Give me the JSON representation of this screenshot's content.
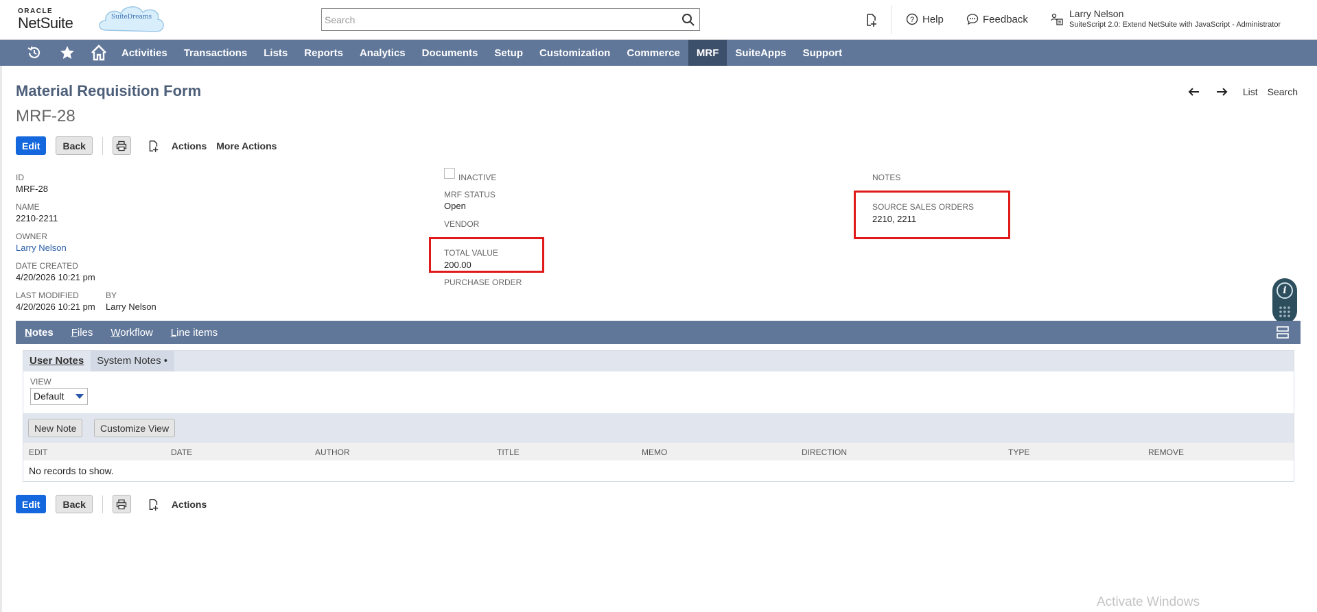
{
  "header": {
    "logo_oracle": "ORACLE",
    "logo_netsuite": "NetSuite",
    "cloud_label": "SuiteDreams",
    "search_placeholder": "Search",
    "help": "Help",
    "feedback": "Feedback",
    "user_name": "Larry Nelson",
    "user_role": "SuiteScript 2.0: Extend NetSuite with JavaScript - Administrator"
  },
  "nav": {
    "items": [
      "Activities",
      "Transactions",
      "Lists",
      "Reports",
      "Analytics",
      "Documents",
      "Setup",
      "Customization",
      "Commerce",
      "MRF",
      "SuiteApps",
      "Support"
    ],
    "active": "MRF"
  },
  "page": {
    "title": "Material Requisition Form",
    "record_id": "MRF-28",
    "top_links": {
      "list": "List",
      "search": "Search"
    }
  },
  "buttons": {
    "edit": "Edit",
    "back": "Back",
    "actions": "Actions",
    "more_actions": "More Actions"
  },
  "fields": {
    "id_label": "ID",
    "id_value": "MRF-28",
    "name_label": "NAME",
    "name_value": "2210-2211",
    "owner_label": "OWNER",
    "owner_value": "Larry Nelson",
    "date_created_label": "DATE CREATED",
    "date_created_value": "4/20/2026 10:21 pm",
    "last_modified_label": "LAST MODIFIED",
    "last_modified_value": "4/20/2026 10:21 pm",
    "by_label": "BY",
    "by_value": "Larry Nelson",
    "inactive_label": "INACTIVE",
    "inactive_checked": false,
    "mrf_status_label": "MRF STATUS",
    "mrf_status_value": "Open",
    "vendor_label": "VENDOR",
    "total_value_label": "TOTAL VALUE",
    "total_value_value": "200.00",
    "purchase_order_label": "PURCHASE ORDER",
    "notes_label": "NOTES",
    "source_sales_orders_label": "SOURCE SALES ORDERS",
    "source_sales_orders_value": "2210, 2211"
  },
  "subtabs": {
    "items": [
      {
        "first": "N",
        "rest": "otes"
      },
      {
        "first": "F",
        "rest": "iles"
      },
      {
        "first": "W",
        "rest": "orkflow"
      },
      {
        "first": "L",
        "rest": "ine items"
      }
    ],
    "active": "Notes"
  },
  "notes": {
    "tab_user": "User Notes",
    "tab_system": "System Notes •",
    "view_label": "VIEW",
    "view_value": "Default",
    "new_note": "New Note",
    "customize_view": "Customize View",
    "columns": [
      "EDIT",
      "DATE",
      "AUTHOR",
      "TITLE",
      "MEMO",
      "DIRECTION",
      "TYPE",
      "REMOVE"
    ],
    "empty_message": "No records to show."
  },
  "watermark": "Activate Windows",
  "colors": {
    "nav_bg": "#607799",
    "nav_active": "#3c4f6b",
    "primary_button": "#1467dc",
    "highlight": "#e01a1a",
    "title": "#4d5f79"
  }
}
